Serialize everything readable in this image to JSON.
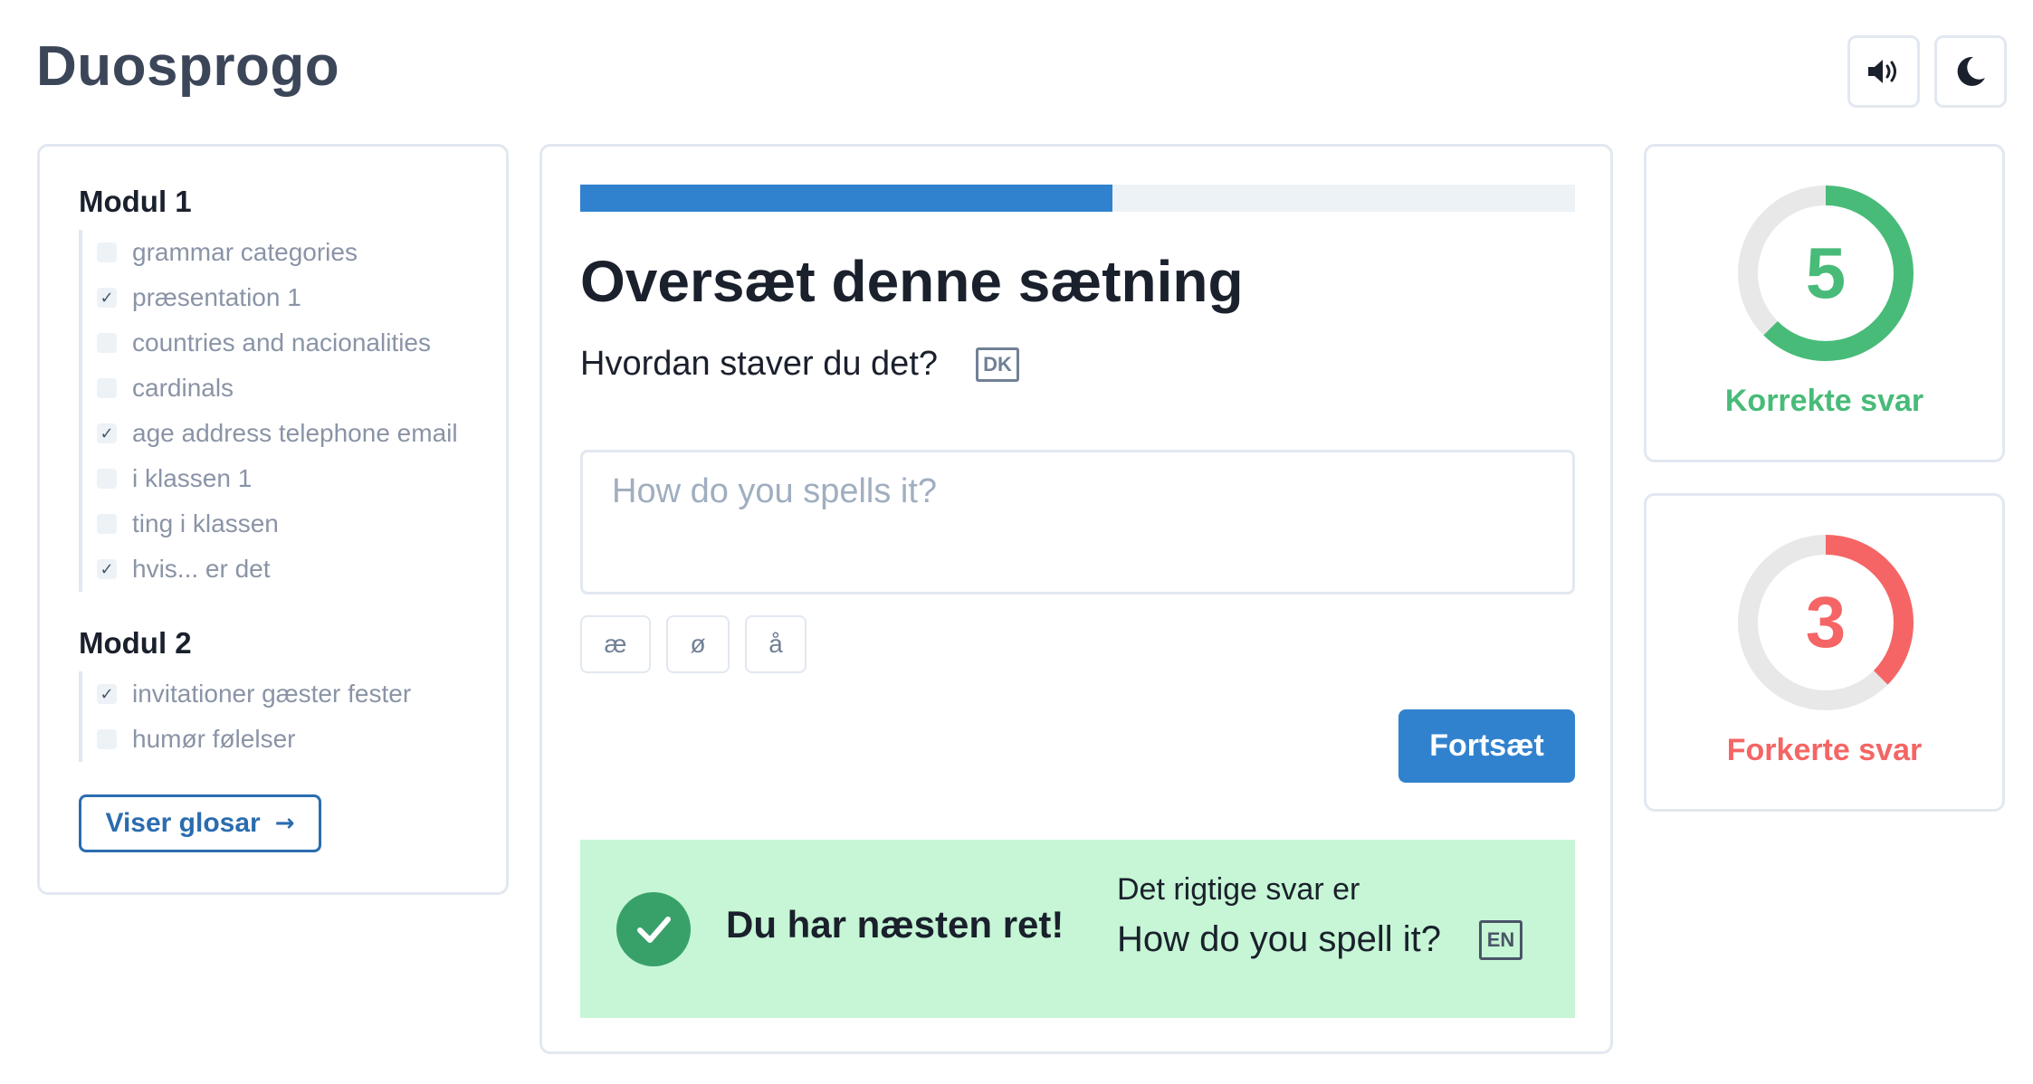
{
  "app": {
    "title": "Duosprogo"
  },
  "header": {
    "sound_icon": "speaker-volume-icon",
    "theme_icon": "moon-icon"
  },
  "sidebar": {
    "modules": [
      {
        "title": "Modul 1",
        "items": [
          {
            "label": "grammar categories",
            "checked": false
          },
          {
            "label": "præsentation 1",
            "checked": true
          },
          {
            "label": "countries and nacionalities",
            "checked": false
          },
          {
            "label": "cardinals",
            "checked": false
          },
          {
            "label": "age address telephone email",
            "checked": true
          },
          {
            "label": "i klassen 1",
            "checked": false
          },
          {
            "label": "ting i klassen",
            "checked": false
          },
          {
            "label": "hvis... er det",
            "checked": true
          }
        ]
      },
      {
        "title": "Modul 2",
        "items": [
          {
            "label": "invitationer gæster fester",
            "checked": true
          },
          {
            "label": "humør følelser",
            "checked": false
          }
        ]
      }
    ],
    "viser_label": "Viser glosar",
    "viser_icon": "arrow-right-icon"
  },
  "exercise": {
    "progress": 0.535,
    "title": "Oversæt denne sætning",
    "sentence": "Hvordan staver du det?",
    "source_lang": "DK",
    "answer_value": "",
    "answer_placeholder": "How do you spells it?",
    "special_chars": [
      "æ",
      "ø",
      "å"
    ],
    "continue_label": "Fortsæt"
  },
  "feedback": {
    "title": "Du har næsten ret!",
    "label": "Det rigtige svar er",
    "answer": "How do you spell it?",
    "answer_lang": "EN",
    "icon": "check-circle-icon"
  },
  "scores": {
    "correct": {
      "value": "5",
      "label": "Korrekte svar",
      "fraction": 0.625,
      "color": "#48bb78"
    },
    "wrong": {
      "value": "3",
      "label": "Forkerte svar",
      "fraction": 0.375,
      "color": "#f56565"
    }
  },
  "colors": {
    "accent": "#3182ce",
    "success_bg": "#c6f6d5",
    "success": "#38a169"
  }
}
